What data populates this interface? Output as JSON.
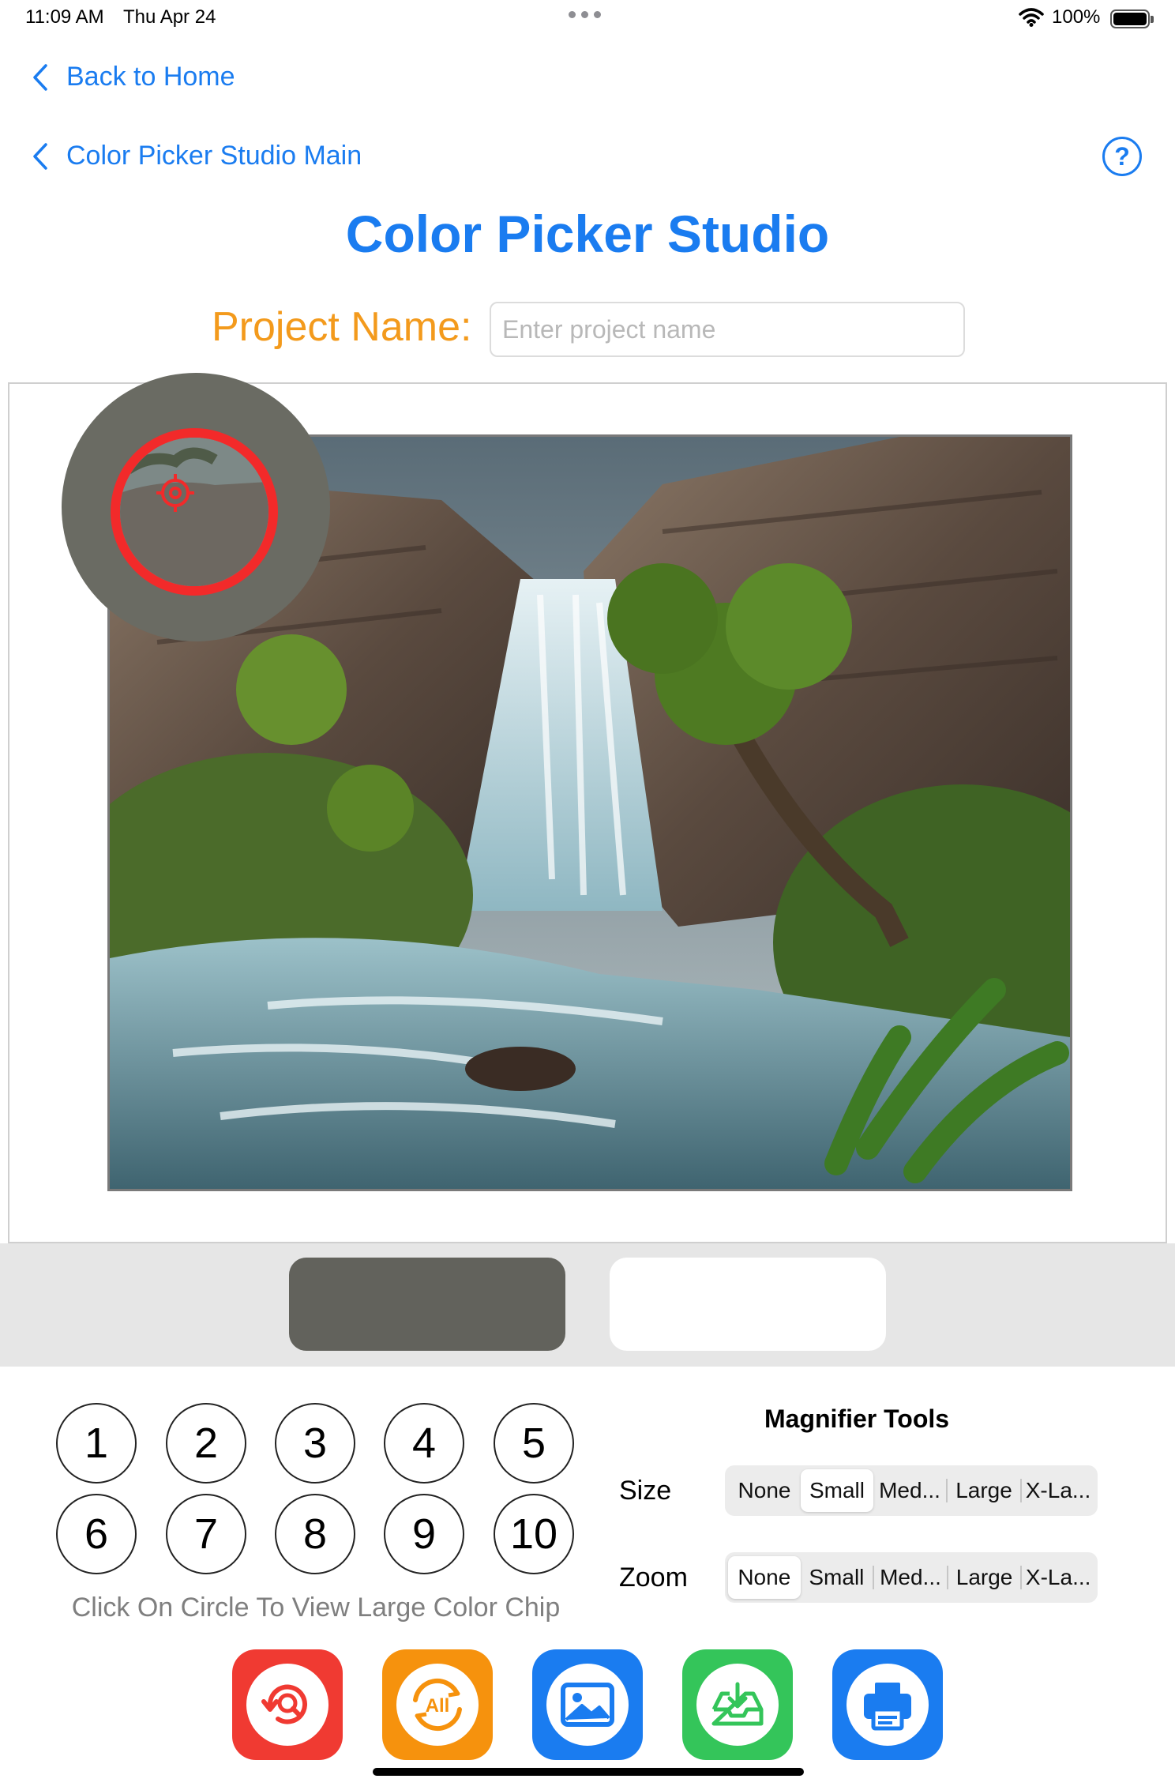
{
  "status_bar": {
    "time": "11:09 AM",
    "date": "Thu Apr 24",
    "battery": "100%"
  },
  "nav": {
    "back_home": "Back to Home",
    "back_main": "Color Picker Studio Main",
    "help_icon": "question-circle-icon"
  },
  "header": {
    "title": "Color Picker Studio",
    "project_label": "Project Name:",
    "project_placeholder": "Enter project name",
    "project_value": ""
  },
  "canvas": {
    "image": "waterfall landscape",
    "magnifier_color": "#6a6b63",
    "reticle_color": "#f22a2a"
  },
  "swatches": {
    "selected_color": "#62625c",
    "secondary_color": "#ffffff"
  },
  "circles": {
    "labels": [
      "1",
      "2",
      "3",
      "4",
      "5",
      "6",
      "7",
      "8",
      "9",
      "10"
    ],
    "hint": "Click On Circle To View Large Color Chip"
  },
  "magnifier_tools": {
    "title": "Magnifier Tools",
    "size_label": "Size",
    "zoom_label": "Zoom",
    "options": [
      "None",
      "Small",
      "Med...",
      "Large",
      "X-La..."
    ],
    "size_selected": "Small",
    "zoom_selected": "None"
  },
  "actions": [
    {
      "icon": "magnify-reset-icon",
      "color": "#f03a32"
    },
    {
      "icon": "refresh-all-icon",
      "color": "#f6920d"
    },
    {
      "icon": "image-icon",
      "color": "#1a7cf0"
    },
    {
      "icon": "save-tray-icon",
      "color": "#34c55a"
    },
    {
      "icon": "printer-icon",
      "color": "#1a7cf0"
    }
  ]
}
